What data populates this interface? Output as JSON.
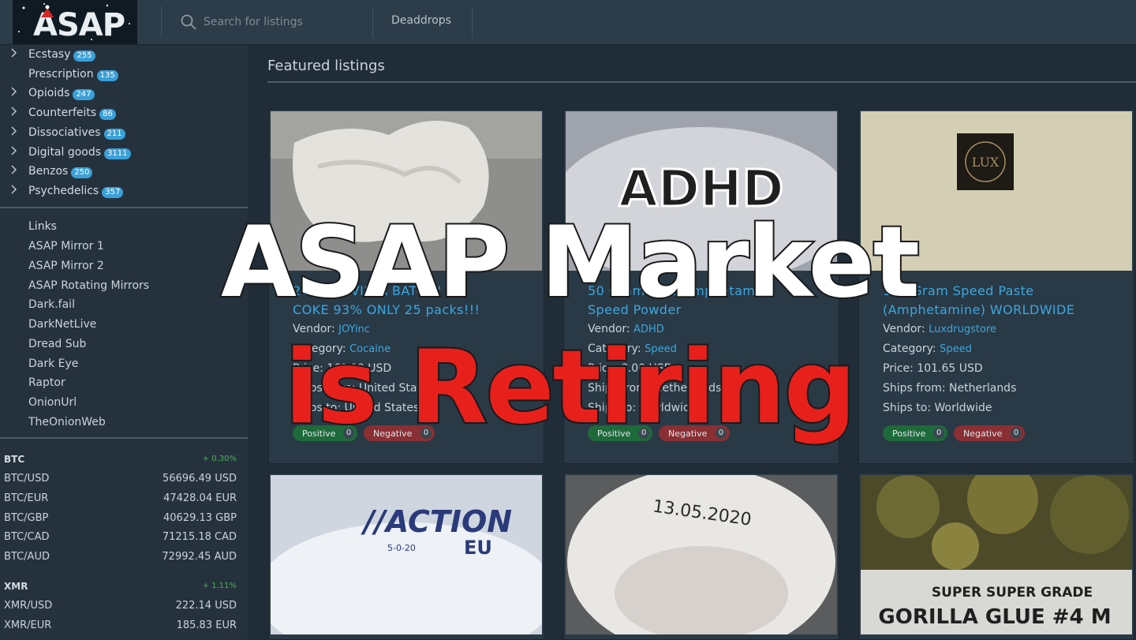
{
  "header": {
    "logo_text": "ASAP",
    "search_placeholder": "Search for listings",
    "nav_link": "Deaddrops"
  },
  "sidebar": {
    "categories": [
      {
        "label": "Ecstasy",
        "count": "255",
        "expandable": true
      },
      {
        "label": "Prescription",
        "count": "135",
        "expandable": false
      },
      {
        "label": "Opioids",
        "count": "247",
        "expandable": true
      },
      {
        "label": "Counterfeits",
        "count": "86",
        "expandable": true
      },
      {
        "label": "Dissociatives",
        "count": "211",
        "expandable": true
      },
      {
        "label": "Digital goods",
        "count": "3111",
        "expandable": true
      },
      {
        "label": "Benzos",
        "count": "250",
        "expandable": true
      },
      {
        "label": "Psychedelics",
        "count": "357",
        "expandable": true
      }
    ],
    "links_heading": "Links",
    "links": [
      "ASAP Mirror 1",
      "ASAP Mirror 2",
      "ASAP Rotating Mirrors",
      "Dark.fail",
      "DarkNetLive",
      "Dread Sub",
      "Dark Eye",
      "Raptor",
      "OnionUrl",
      "TheOnionWeb"
    ],
    "rates": {
      "btc": {
        "name": "BTC",
        "change": "+ 0.30%",
        "pairs": [
          {
            "label": "BTC/USD",
            "value": "56696.49 USD"
          },
          {
            "label": "BTC/EUR",
            "value": "47428.04 EUR"
          },
          {
            "label": "BTC/GBP",
            "value": "40629.13 GBP"
          },
          {
            "label": "BTC/CAD",
            "value": "71215.18 CAD"
          },
          {
            "label": "BTC/AUD",
            "value": "72992.45 AUD"
          }
        ]
      },
      "xmr": {
        "name": "XMR",
        "change": "+ 1.11%",
        "pairs": [
          {
            "label": "XMR/USD",
            "value": "222.14 USD"
          },
          {
            "label": "XMR/EUR",
            "value": "185.83 EUR"
          }
        ]
      }
    }
  },
  "main": {
    "title": "Featured listings",
    "listings": [
      {
        "title_line1": "20 G \"SEVILLA BATCH\"",
        "title_line2": "COKE 93% ONLY 25 packs!!!",
        "vendor_label": "Vendor:",
        "vendor": "JOYinc",
        "category_label": "Category:",
        "category": "Cocaine",
        "price": "Price: 16?.00 USD",
        "ships_from": "Ships from: United States",
        "ships_to": "Ships to: United States",
        "positive_label": "Positive",
        "positive": "0",
        "negative_label": "Negative",
        "negative": "0"
      },
      {
        "title_line1": "50 Gram Pure Amphetamine",
        "title_line2": "Speed Powder",
        "vendor_label": "Vendor:",
        "vendor": "ADHD",
        "category_label": "Category:",
        "category": "Speed",
        "price": "Price: ?.00 USD",
        "ships_from": "Ships from: Netherlands",
        "ships_to": "Ships to: Worldwide",
        "positive_label": "Positive",
        "positive": "0",
        "negative_label": "Negative",
        "negative": "0"
      },
      {
        "title_line1": "100 Gram Speed Paste",
        "title_line2": "(Amphetamine) WORLDWIDE",
        "vendor_label": "Vendor:",
        "vendor": "Luxdrugstore",
        "category_label": "Category:",
        "category": "Speed",
        "price": "Price: 101.65 USD",
        "ships_from": "Ships from: Netherlands",
        "ships_to": "Ships to: Worldwide",
        "positive_label": "Positive",
        "positive": "0",
        "negative_label": "Negative",
        "negative": "0"
      }
    ],
    "images": {
      "img2_text": "ADHD",
      "img3_text": "LUX",
      "img4_text": "//ACTION",
      "img4_sub": "EU",
      "img4_date": "5-0-20",
      "img5_text": "13.05.2020",
      "img6_line1": "SUPER SUPER GRADE",
      "img6_line2": "GORILLA GLUE #4 M"
    }
  },
  "overlay": {
    "line1": "ASAP Market",
    "line2": "is Retiring",
    "colors": {
      "line1": "#ffffff",
      "line2": "#e8201c"
    }
  },
  "colors": {
    "accent": "#3aa8e0",
    "badge": "#3aa0d8",
    "positive": "#1e6a3a",
    "negative": "#8a2f33",
    "rate_up": "#4cb050"
  }
}
